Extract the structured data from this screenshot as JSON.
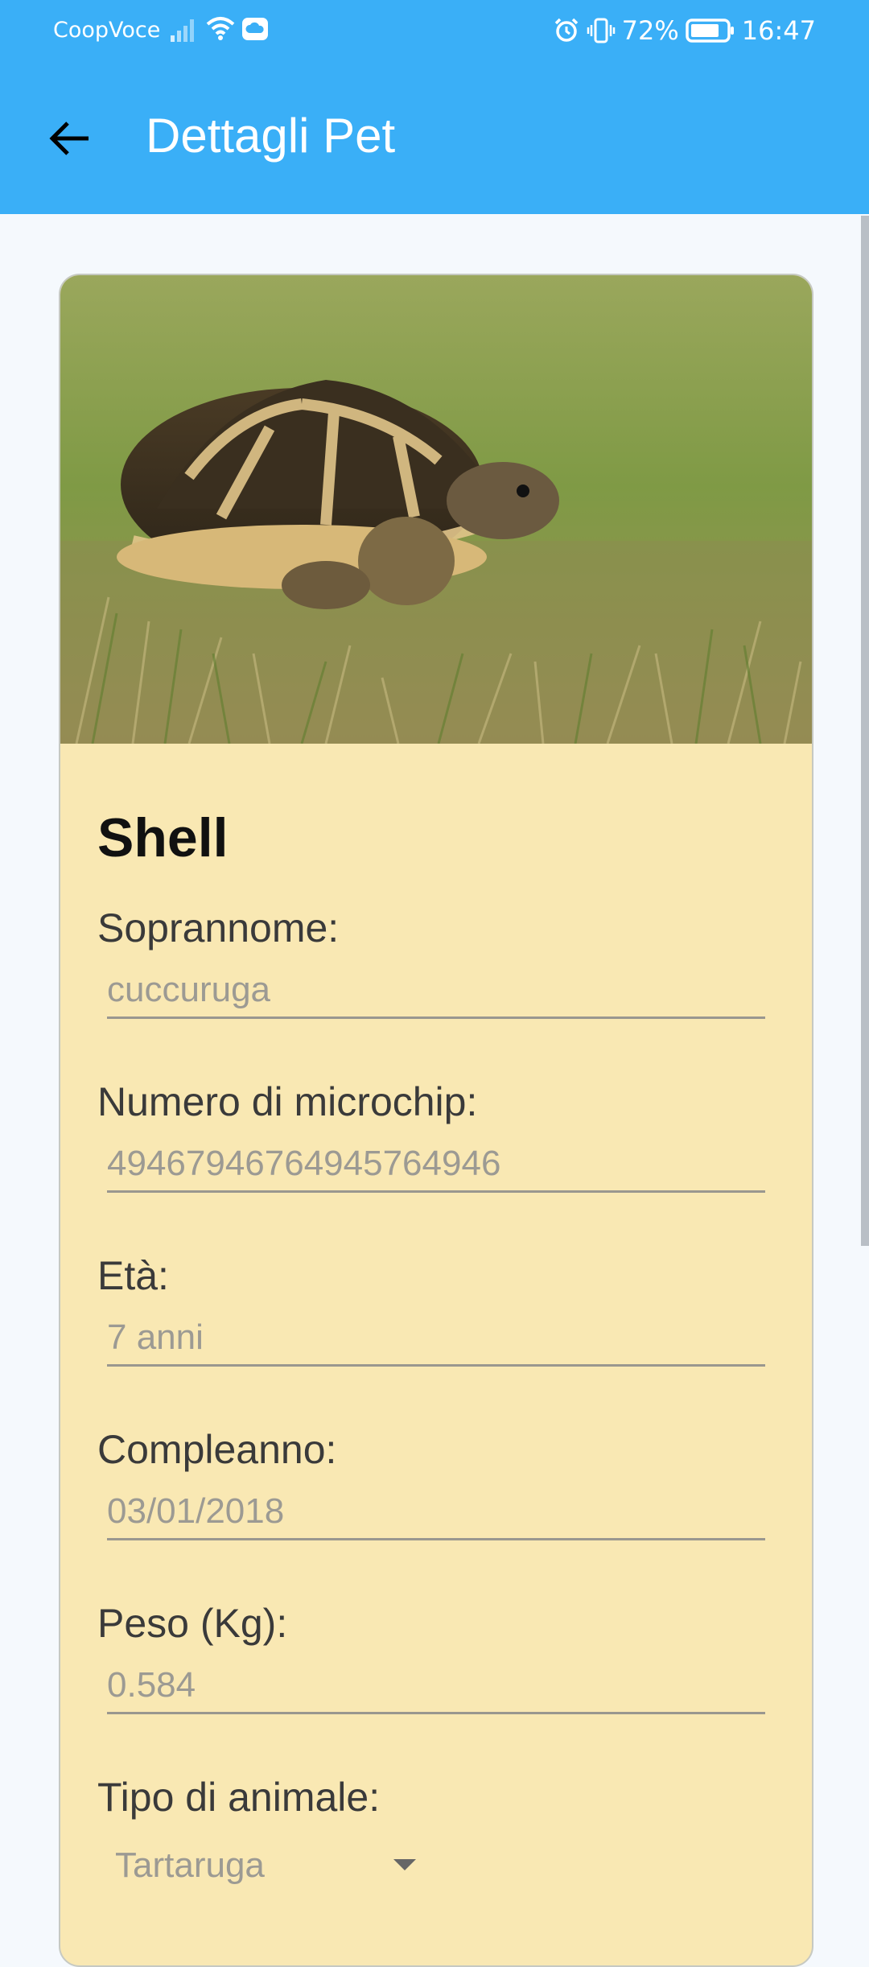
{
  "status_bar": {
    "carrier": "CoopVoce",
    "battery": "72%",
    "time": "16:47",
    "icons": [
      "signal-icon",
      "wifi-icon",
      "cloud-icon",
      "alarm-icon",
      "vibrate-icon",
      "battery-icon"
    ]
  },
  "app_bar": {
    "title": "Dettagli Pet",
    "back_icon": "arrow-back-icon",
    "background": "#3aaff7"
  },
  "pet": {
    "name": "Shell",
    "fields": [
      {
        "label": "Soprannome:",
        "value": "cuccuruga"
      },
      {
        "label": "Numero di microchip:",
        "value": "49467946764945764946"
      },
      {
        "label": "Età:",
        "value": "7 anni"
      },
      {
        "label": "Compleanno:",
        "value": "03/01/2018"
      },
      {
        "label": "Peso (Kg):",
        "value": "0.584"
      }
    ],
    "type_field": {
      "label": "Tipo di animale:",
      "value": "Tartaruga"
    }
  },
  "colors": {
    "card_background": "#f9e8b3",
    "accent": "#3aaff7"
  }
}
